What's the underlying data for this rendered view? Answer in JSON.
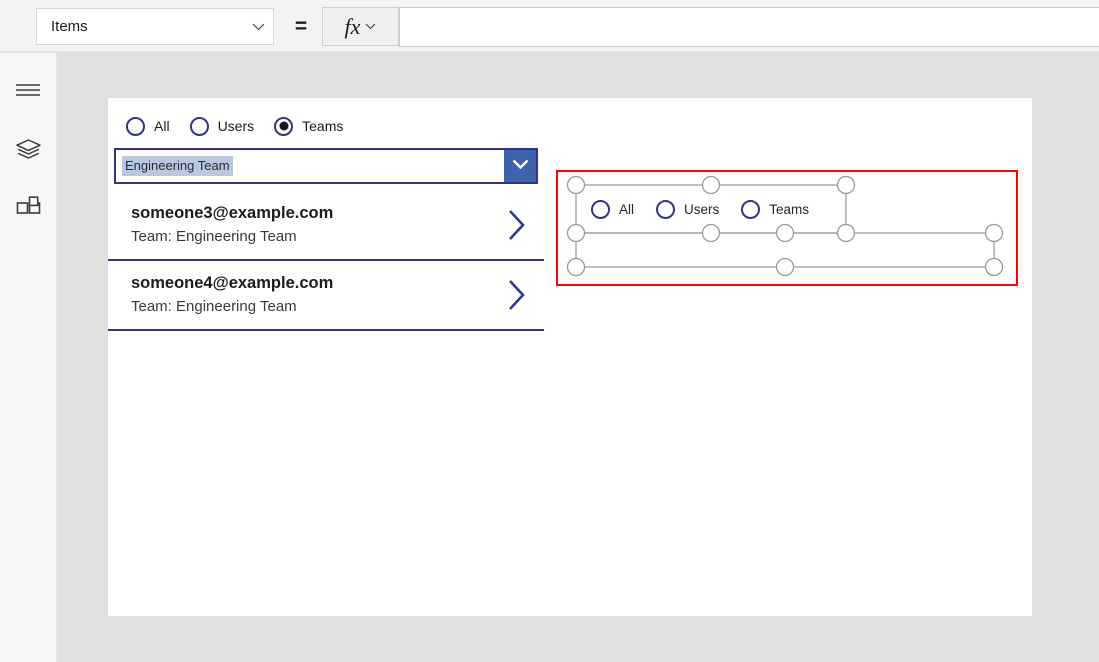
{
  "formula_bar": {
    "property_value": "Items",
    "property_chevron_icon": "chevron-down-icon",
    "equals": "=",
    "fx_label": "fx",
    "fx_chevron_icon": "chevron-down-icon",
    "formula_value": "",
    "formula_placeholder": ""
  },
  "left_rail": {
    "items": [
      {
        "name": "menu",
        "icon": "hamburger-menu-icon"
      },
      {
        "name": "tree-view",
        "icon": "layers-icon"
      },
      {
        "name": "insert",
        "icon": "components-grid-icon"
      }
    ]
  },
  "canvas": {
    "radio_group": {
      "options": [
        {
          "label": "All",
          "selected": false
        },
        {
          "label": "Users",
          "selected": false
        },
        {
          "label": "Teams",
          "selected": true
        }
      ]
    },
    "dropdown": {
      "value": "Engineering Team",
      "chevron_icon": "chevron-down-icon"
    },
    "gallery": {
      "items": [
        {
          "title": "someone3@example.com",
          "subtitle": "Team: Engineering Team",
          "chevron_icon": "chevron-right-icon"
        },
        {
          "title": "someone4@example.com",
          "subtitle": "Team: Engineering Team",
          "chevron_icon": "chevron-right-icon"
        }
      ]
    },
    "selected_control": {
      "options": [
        {
          "label": "All",
          "selected": false
        },
        {
          "label": "Users",
          "selected": false
        },
        {
          "label": "Teams",
          "selected": false
        }
      ],
      "selection_border_color": "#ff0000",
      "handle_stroke_color": "#9a9a9a"
    }
  },
  "colors": {
    "accent_navy": "#32357e",
    "dropdown_button_blue": "#3e63ad",
    "selection_highlight": "#b8c8e0",
    "canvas_background": "#ffffff",
    "workarea_background": "#e0e0e0",
    "rail_background": "#f7f7f7",
    "formula_bar_background": "#f3f3f3",
    "error_red": "#ff0000"
  }
}
